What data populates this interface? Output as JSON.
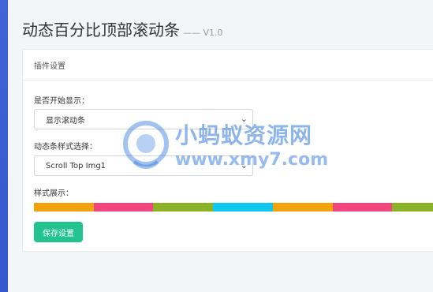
{
  "page": {
    "title": "动态百分比顶部滚动条",
    "version": "—— V1.0"
  },
  "card": {
    "header": "插件设置",
    "start_display_label": "是否开始显示：",
    "start_display_value": "显示滚动条",
    "style_label": "动态条样式选择：",
    "style_value": "Scroll Top Img1",
    "preview_label": "样式展示：",
    "save_label": "保存设置"
  },
  "preview_colors": [
    "#f2a20d",
    "#f0457e",
    "#8bb125",
    "#12c7ef",
    "#f2a20d",
    "#f0457e",
    "#8bb125"
  ],
  "watermark": {
    "cn": "小蚂蚁资源网",
    "url": "www.xmy7.com"
  },
  "icons": {
    "select_arrow": "chevron-down-icon",
    "watermark_logo": "ant-logo-icon"
  }
}
